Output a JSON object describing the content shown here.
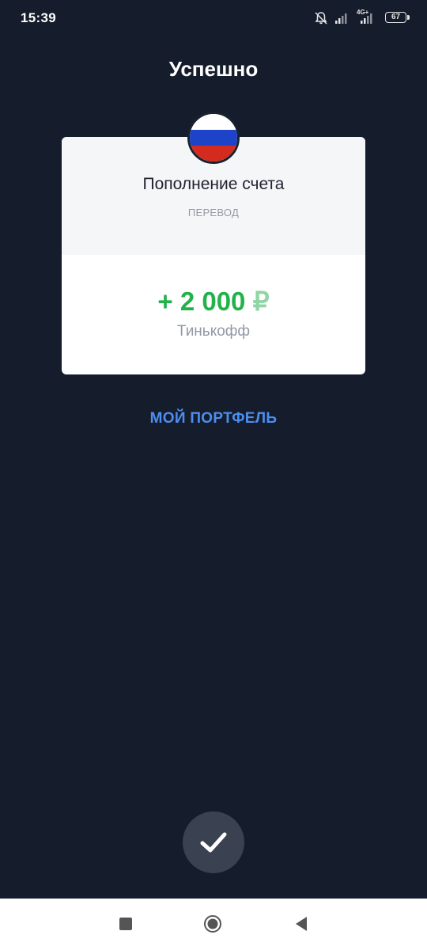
{
  "status_bar": {
    "time": "15:39",
    "network": "4G+",
    "battery": "67",
    "icons": [
      "bell-muted-icon",
      "signal-icon",
      "signal-icon",
      "battery-icon"
    ]
  },
  "header": {
    "title": "Успешно"
  },
  "card": {
    "flag": "russia-flag-icon",
    "name": "Пополнение счета",
    "type": "ПЕРЕВОД",
    "amount": "+ 2 000",
    "currency": "₽",
    "bank": "Тинькофф",
    "colors": {
      "amount": "#22b24c",
      "currency": "#8fd6a4"
    }
  },
  "links": {
    "portfolio": "МОЙ ПОРТФЕЛЬ"
  },
  "actions": {
    "done_icon": "checkmark-icon"
  },
  "nav_bar": {
    "icons": [
      "recent-apps-icon",
      "home-icon",
      "back-icon"
    ]
  },
  "colors": {
    "background": "#151c2b",
    "link": "#4d8ef0",
    "button": "#3a4150"
  }
}
